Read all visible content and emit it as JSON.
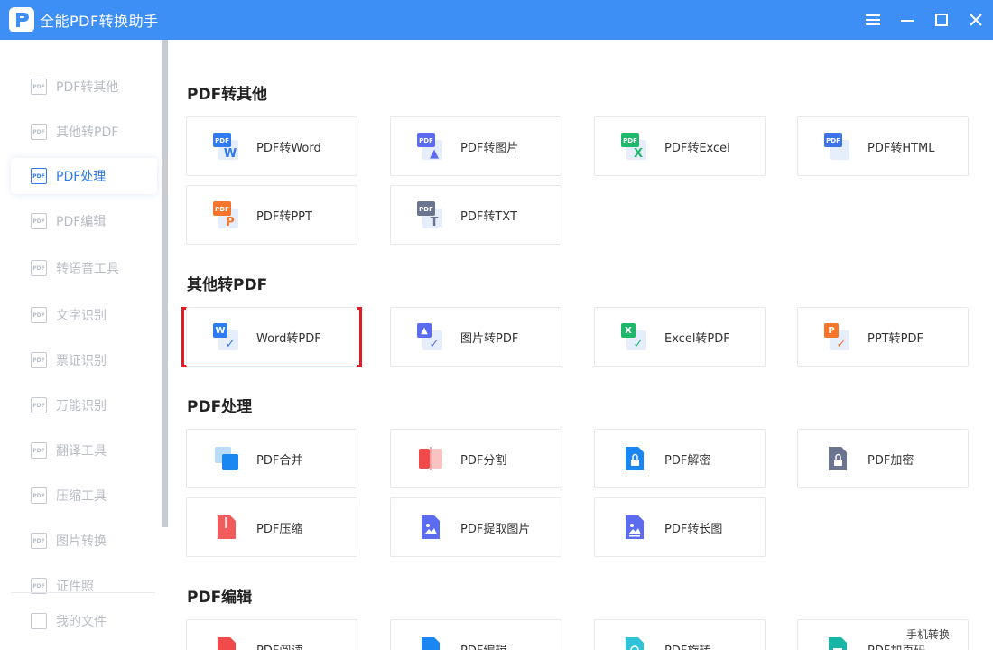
{
  "app": {
    "title": "全能PDF转换助手"
  },
  "window_controls": [
    "menu",
    "minimize",
    "maximize",
    "close"
  ],
  "sidebar": {
    "items": [
      {
        "label": "PDF转其他",
        "icon": "pdf-doc-icon",
        "active": false
      },
      {
        "label": "其他转PDF",
        "icon": "pdf-doc-icon",
        "active": false
      },
      {
        "label": "PDF处理",
        "icon": "pdf-doc-icon",
        "active": true
      },
      {
        "label": "PDF编辑",
        "icon": "pdf-doc-icon",
        "active": false
      },
      {
        "label": "转语音工具",
        "icon": "text-to-speech-icon",
        "active": false
      },
      {
        "label": "文字识别",
        "icon": "ocr-icon",
        "active": false
      },
      {
        "label": "票证识别",
        "icon": "ticket-icon",
        "active": false
      },
      {
        "label": "万能识别",
        "icon": "scan-icon",
        "active": false
      },
      {
        "label": "翻译工具",
        "icon": "translate-icon",
        "active": false
      },
      {
        "label": "压缩工具",
        "icon": "compress-icon",
        "active": false
      },
      {
        "label": "图片转换",
        "icon": "image-convert-icon",
        "active": false
      },
      {
        "label": "证件照",
        "icon": "id-photo-icon",
        "active": false
      }
    ],
    "footer": {
      "label": "我的文件",
      "icon": "my-files-icon"
    }
  },
  "sections": [
    {
      "title": "PDF转其他",
      "cards": [
        {
          "label": "PDF转Word",
          "badge": "PDF",
          "color": "#2f7bef",
          "mark": "W"
        },
        {
          "label": "PDF转图片",
          "badge": "PDF",
          "color": "#5b6cf0",
          "mark": "▲"
        },
        {
          "label": "PDF转Excel",
          "badge": "PDF",
          "color": "#1fb86a",
          "mark": "X"
        },
        {
          "label": "PDF转HTML",
          "badge": "PDF",
          "color": "#3d73e8",
          "mark": "</>"
        },
        {
          "label": "PDF转PPT",
          "badge": "PDF",
          "color": "#f5762b",
          "mark": "P"
        },
        {
          "label": "PDF转TXT",
          "badge": "PDF",
          "color": "#6b7592",
          "mark": "T"
        }
      ]
    },
    {
      "title": "其他转PDF",
      "cards": [
        {
          "label": "Word转PDF",
          "badge": "W",
          "color": "#2f7bef",
          "mark": "✓"
        },
        {
          "label": "图片转PDF",
          "badge": "▲",
          "color": "#5b6cf0",
          "mark": "✓"
        },
        {
          "label": "Excel转PDF",
          "badge": "X",
          "color": "#1fb86a",
          "mark": "✓"
        },
        {
          "label": "PPT转PDF",
          "badge": "P",
          "color": "#f5762b",
          "mark": "✓"
        }
      ]
    },
    {
      "title": "PDF处理",
      "cards": [
        {
          "label": "PDF合并",
          "color": "#1a86f2",
          "kind": "merge"
        },
        {
          "label": "PDF分割",
          "color": "#f04a4a",
          "kind": "split"
        },
        {
          "label": "PDF解密",
          "color": "#1a86f2",
          "kind": "lock-open"
        },
        {
          "label": "PDF加密",
          "color": "#6b7592",
          "kind": "lock"
        },
        {
          "label": "PDF压缩",
          "color": "#f25b5b",
          "kind": "zip"
        },
        {
          "label": "PDF提取图片",
          "color": "#5b6cf0",
          "kind": "image"
        },
        {
          "label": "PDF转长图",
          "color": "#5b6cf0",
          "kind": "long-image"
        }
      ]
    },
    {
      "title": "PDF编辑",
      "cards": [
        {
          "label": "PDF阅读",
          "color": "#f04a4a",
          "kind": "read"
        },
        {
          "label": "PDF编辑",
          "color": "#1a86f2",
          "kind": "edit"
        },
        {
          "label": "PDF旋转",
          "color": "#2ec3d6",
          "kind": "rotate"
        },
        {
          "label": "PDF加页码",
          "color": "#16b5a6",
          "kind": "page-num"
        }
      ]
    }
  ],
  "mobile_convert": {
    "label": "手机转换"
  },
  "colors": {
    "titlebar": "#3d8ff5",
    "accent": "#2f7bef",
    "highlight": "#e31b23"
  }
}
